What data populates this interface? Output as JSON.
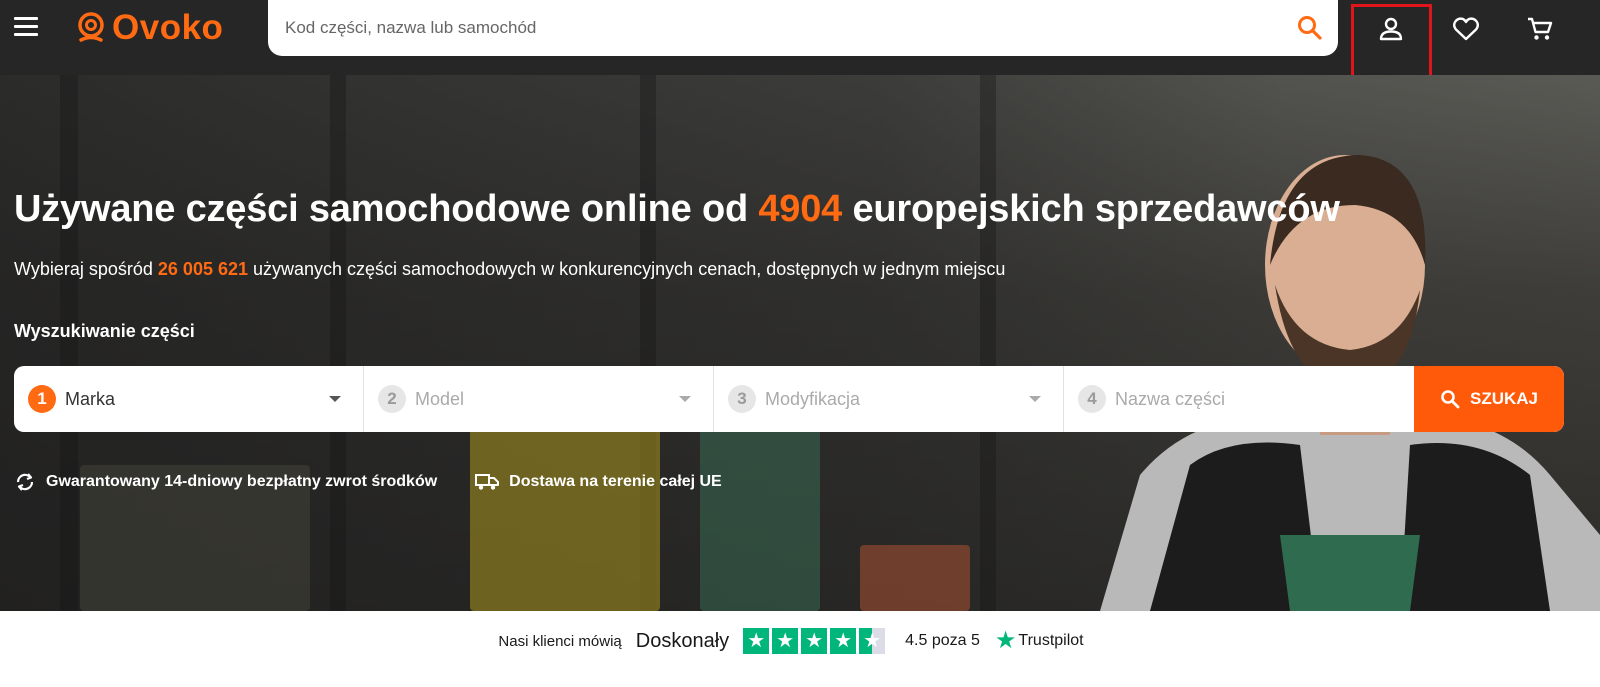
{
  "header": {
    "brand": "Ovoko",
    "search_placeholder": "Kod części, nazwa lub samochód",
    "brand_color": "#ff6a13",
    "icons": [
      "menu-icon",
      "search-icon",
      "user-icon",
      "heart-icon",
      "cart-icon"
    ]
  },
  "hero": {
    "headline_pre": "Używane części samochodowe online od ",
    "headline_count": "4904",
    "headline_post": " europejskich sprzedawców",
    "sub_pre": "Wybieraj spośród ",
    "sub_count": "26 005 621",
    "sub_post": " używanych części samochodowych w konkurencyjnych cenach, dostępnych w jednym miejscu",
    "section_label": "Wyszukiwanie części"
  },
  "selector": {
    "fields": [
      {
        "num": "1",
        "label": "Marka"
      },
      {
        "num": "2",
        "label": "Model"
      },
      {
        "num": "3",
        "label": "Modyfikacja"
      },
      {
        "num": "4",
        "label": "Nazwa części"
      }
    ],
    "search_button": "SZUKAJ"
  },
  "benefits": [
    {
      "icon": "refresh-icon",
      "label": "Gwarantowany 14-dniowy bezpłatny zwrot środków"
    },
    {
      "icon": "truck-icon",
      "label": "Dostawa na terenie całej UE"
    }
  ],
  "trust": {
    "says": "Nasi klienci mówią",
    "rating_word": "Doskonały",
    "stars": 4.5,
    "score": "4.5 poza 5",
    "brand": "Trustpilot",
    "color": "#00b67a"
  }
}
